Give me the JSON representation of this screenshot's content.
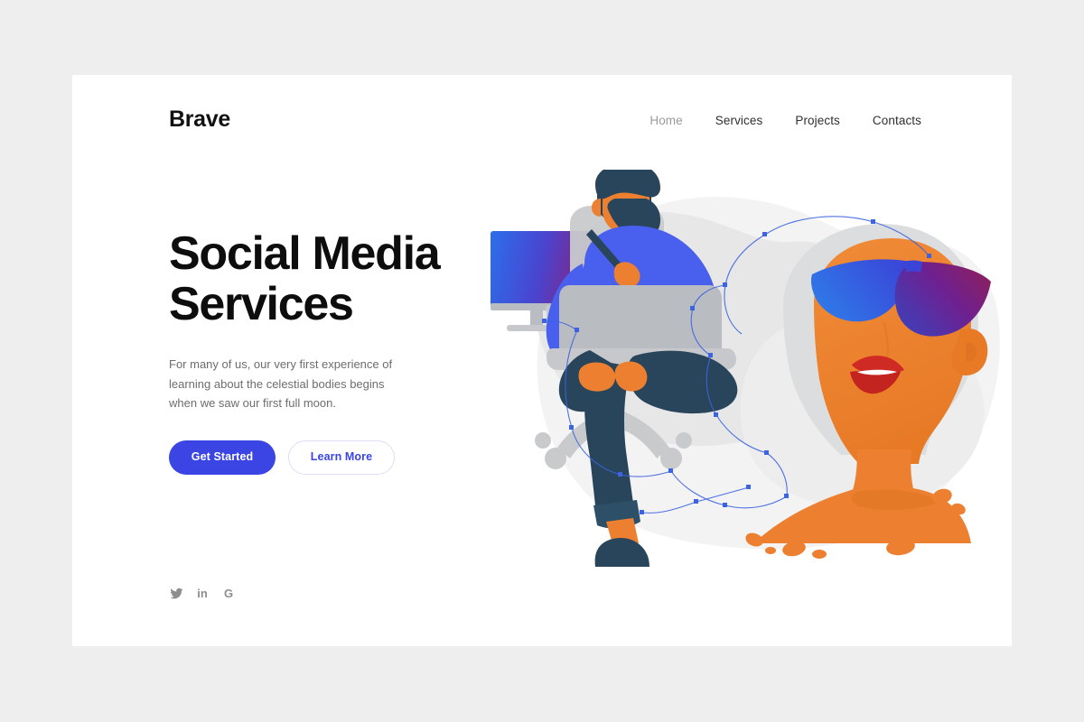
{
  "meta": {
    "background_color": "#eeeeee",
    "card_color": "#ffffff",
    "accent_color": "#3a45e4",
    "muted_text_color": "#6d6d6d",
    "nav_active_color": "#9b9b9b"
  },
  "header": {
    "brand": "Brave",
    "nav": [
      {
        "label": "Home",
        "muted": true
      },
      {
        "label": "Services",
        "muted": false
      },
      {
        "label": "Projects",
        "muted": false
      },
      {
        "label": "Contacts",
        "muted": false
      }
    ]
  },
  "hero": {
    "title_line_1": "Social Media",
    "title_line_2": "Services",
    "description": "For many of us, our very first experience of learning about the celestial bodies begins when we saw our first full moon.",
    "primary_button": "Get Started",
    "secondary_button": "Learn More"
  },
  "social": [
    {
      "name": "twitter",
      "glyph": ""
    },
    {
      "name": "linkedin",
      "glyph": "in"
    },
    {
      "name": "google",
      "glyph": "G"
    }
  ],
  "illustration": {
    "description": "Flat vector illustration: a bearded man in a blue shirt sits cross-legged on a grey office chair working on a laptop beside a monitor with a blue-to-magenta gradient screen; to the right a large orange portrait of a woman wearing blue-to-magenta gradient sunglasses with red lips and light grey hair; thin blue vector paths with square anchor nodes connect the two over pale grey organic background blobs.",
    "colors": {
      "blob_light": "#f4f4f4",
      "blob_mid": "#e6e6e6",
      "skin_orange": "#ed8030",
      "navy": "#28455b",
      "shirt_blue": "#4960ef",
      "grey_device": "#b9bcc0",
      "grey_chair": "#c8cacc",
      "lips_red": "#cf2a24",
      "hair_grey": "#d9dadc",
      "node_blue": "#3c63e0",
      "screen_gradient_from": "#2f6ae8",
      "screen_gradient_to": "#8e1f73",
      "glasses_gradient_from": "#2f6ae8",
      "glasses_gradient_to": "#8e1f73"
    }
  }
}
